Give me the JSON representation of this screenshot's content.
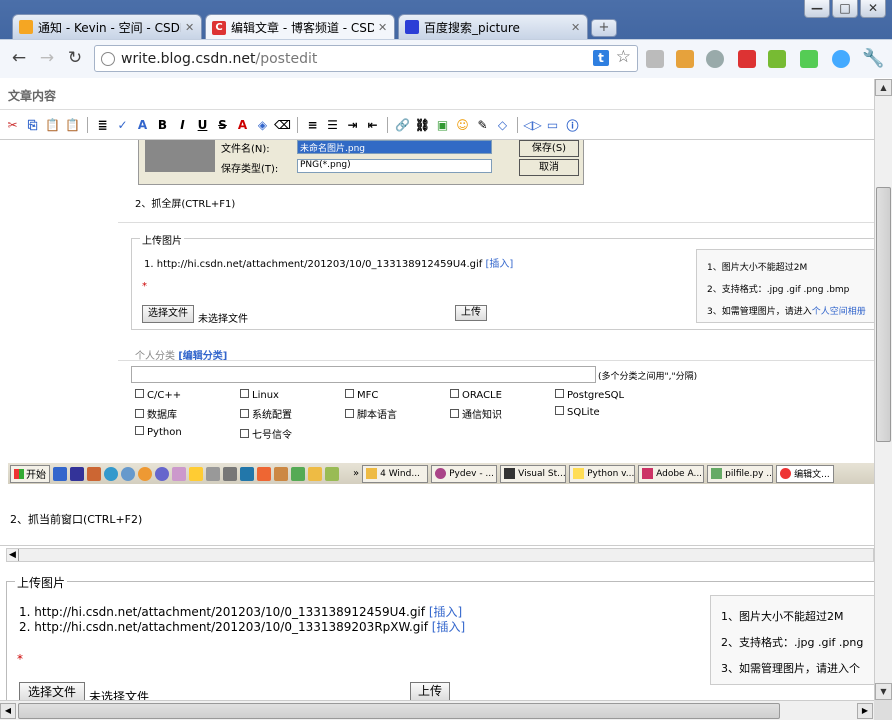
{
  "window": {
    "minimize": "—",
    "maximize": "□",
    "close": "✕"
  },
  "tabs": [
    {
      "title": "通知 - Kevin - 空间 - CSDN.NE",
      "icon": "house-icon",
      "color": "#f5a623"
    },
    {
      "title": "编辑文章 - 博客频道 - CSDN",
      "icon": "csdn-icon",
      "color": "#d33"
    },
    {
      "title": "百度搜索_picture",
      "icon": "baidu-paw-icon",
      "color": "#2b3ed6"
    }
  ],
  "address": {
    "host": "write.blog.csdn.net",
    "path": "/postedit"
  },
  "page": {
    "section_title": "文章内容",
    "dialog": {
      "filename_label": "文件名(N):",
      "filename_value": "未命名图片.png",
      "type_label": "保存类型(T):",
      "type_value": "PNG(*.png)",
      "save": "保存(S)",
      "cancel": "取消"
    },
    "step_full": "2、抓全屏(CTRL+F1)",
    "upload_legend": "上传图片",
    "upload_list": [
      {
        "num": "1.",
        "url": "http://hi.csdn.net/attachment/201203/10/0_133138912459U4.gif",
        "insert": "[插入]"
      }
    ],
    "required": "*",
    "choose_file": "选择文件",
    "no_file": "未选择文件",
    "upload_btn": "上传",
    "info": [
      "1、图片大小不能超过2M",
      "2、支持格式：.jpg .gif .png .bmp",
      "3、如需管理图片，请进入"
    ],
    "info_link": "个人空间相册",
    "category_label": "个人分类",
    "category_edit": "[编辑分类]",
    "category_hint": "(多个分类之间用\",\"分隔)",
    "categories": [
      "C/C++",
      "Linux",
      "MFC",
      "ORACLE",
      "PostgreSQL",
      "数据库",
      "系统配置",
      "脚本语言",
      "通信知识",
      "SQLite",
      "Python",
      "七号信令"
    ],
    "step_window": "2、抓当前窗口(CTRL+F2)",
    "upload2_legend": "上传图片",
    "upload2_list": [
      {
        "num": "1.",
        "url": "http://hi.csdn.net/attachment/201203/10/0_133138912459U4.gif",
        "insert": "[插入]"
      },
      {
        "num": "2.",
        "url": "http://hi.csdn.net/attachment/201203/10/0_1331389203RpXW.gif",
        "insert": "[插入]"
      }
    ],
    "info2": [
      "1、图片大小不能超过2M",
      "2、支持格式：.jpg .gif .png",
      "3、如需管理图片，请进入个"
    ]
  },
  "taskbar": {
    "start": "开始",
    "items": [
      "4 Wind...",
      "Pydev - ...",
      "Visual St...",
      "Python v...",
      "Adobe A...",
      "pilfile.py ...",
      "编辑文..."
    ]
  }
}
